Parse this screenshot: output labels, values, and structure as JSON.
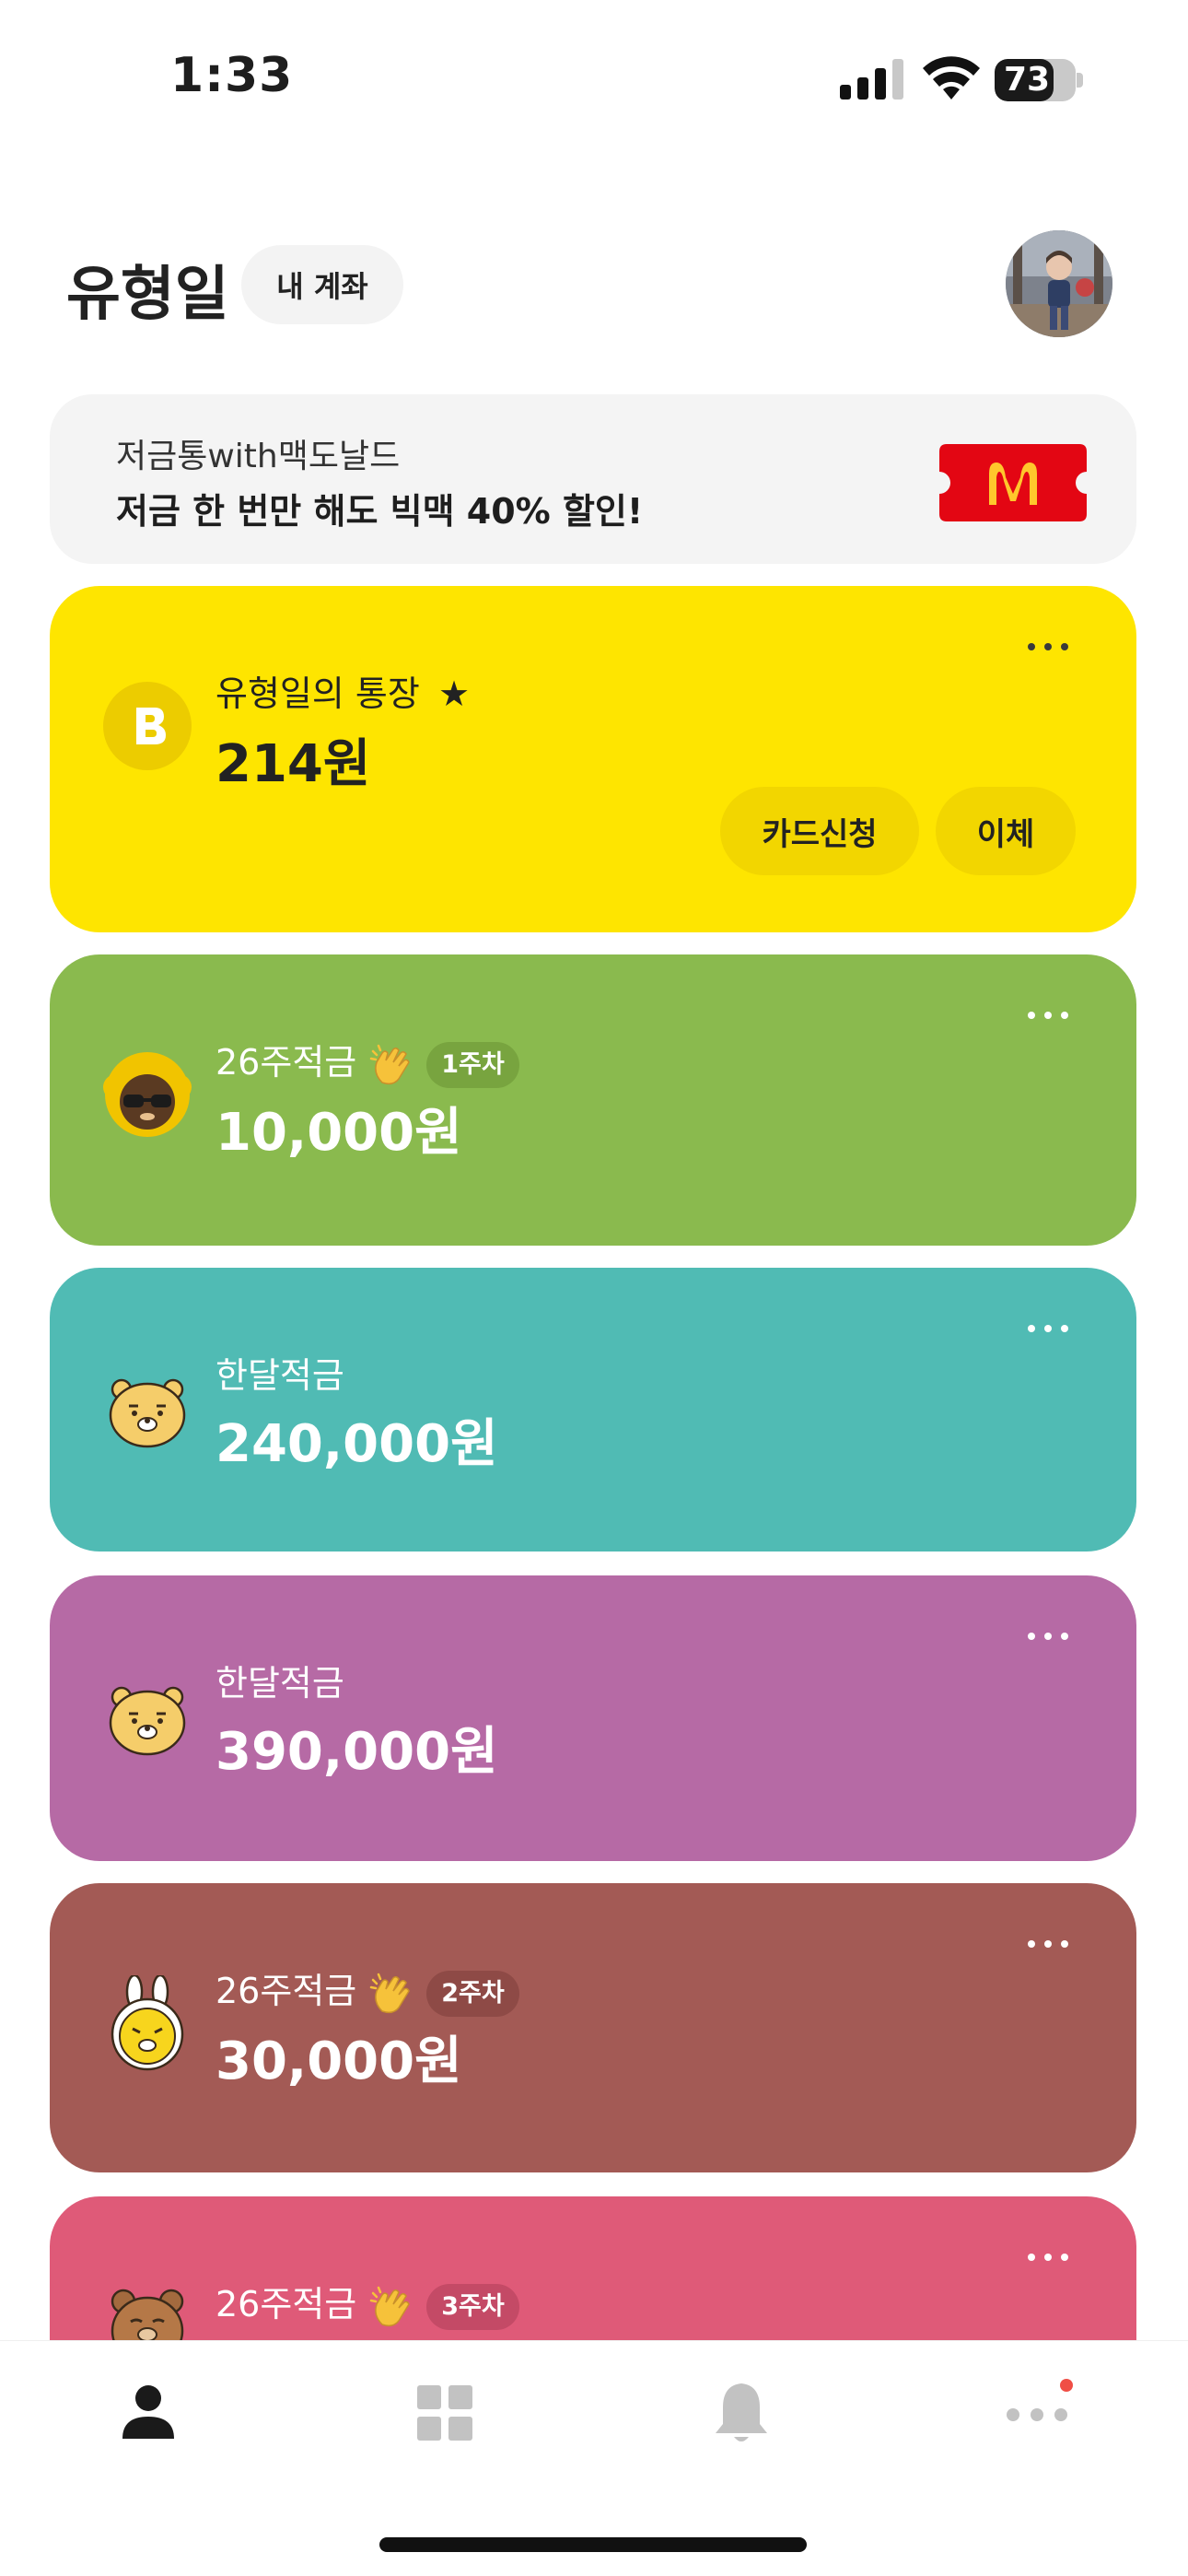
{
  "status_bar": {
    "time": "1:33",
    "battery_level": "73"
  },
  "header": {
    "username": "유형일",
    "my_account_label": "내 계좌"
  },
  "promo": {
    "subtitle": "저금통with맥도날드",
    "title": "저금 한 번만 해도 빅맥 40% 할인!"
  },
  "accounts": [
    {
      "name": "유형일의 통장",
      "amount": "214원",
      "starred": true,
      "color": "#fee500",
      "buttons": [
        "카드신청",
        "이체"
      ]
    },
    {
      "name": "26주적금",
      "amount": "10,000원",
      "week_badge": "1주차",
      "color": "#8aba4e"
    },
    {
      "name": "한달적금",
      "amount": "240,000원",
      "color": "#50bbb4"
    },
    {
      "name": "한달적금",
      "amount": "390,000원",
      "color": "#b66aa5"
    },
    {
      "name": "26주적금",
      "amount": "30,000원",
      "week_badge": "2주차",
      "color": "#a35a55"
    },
    {
      "name": "26주적금",
      "amount": "",
      "week_badge": "3주차",
      "color": "#df5a78"
    }
  ],
  "bottom_nav": {
    "items": [
      "person-icon",
      "grid-icon",
      "bell-icon",
      "more-icon"
    ],
    "active_index": 0
  },
  "colors": {
    "accent_yellow": "#fee500",
    "notification_dot": "#f04e45",
    "mcdonalds_red": "#e30613"
  }
}
